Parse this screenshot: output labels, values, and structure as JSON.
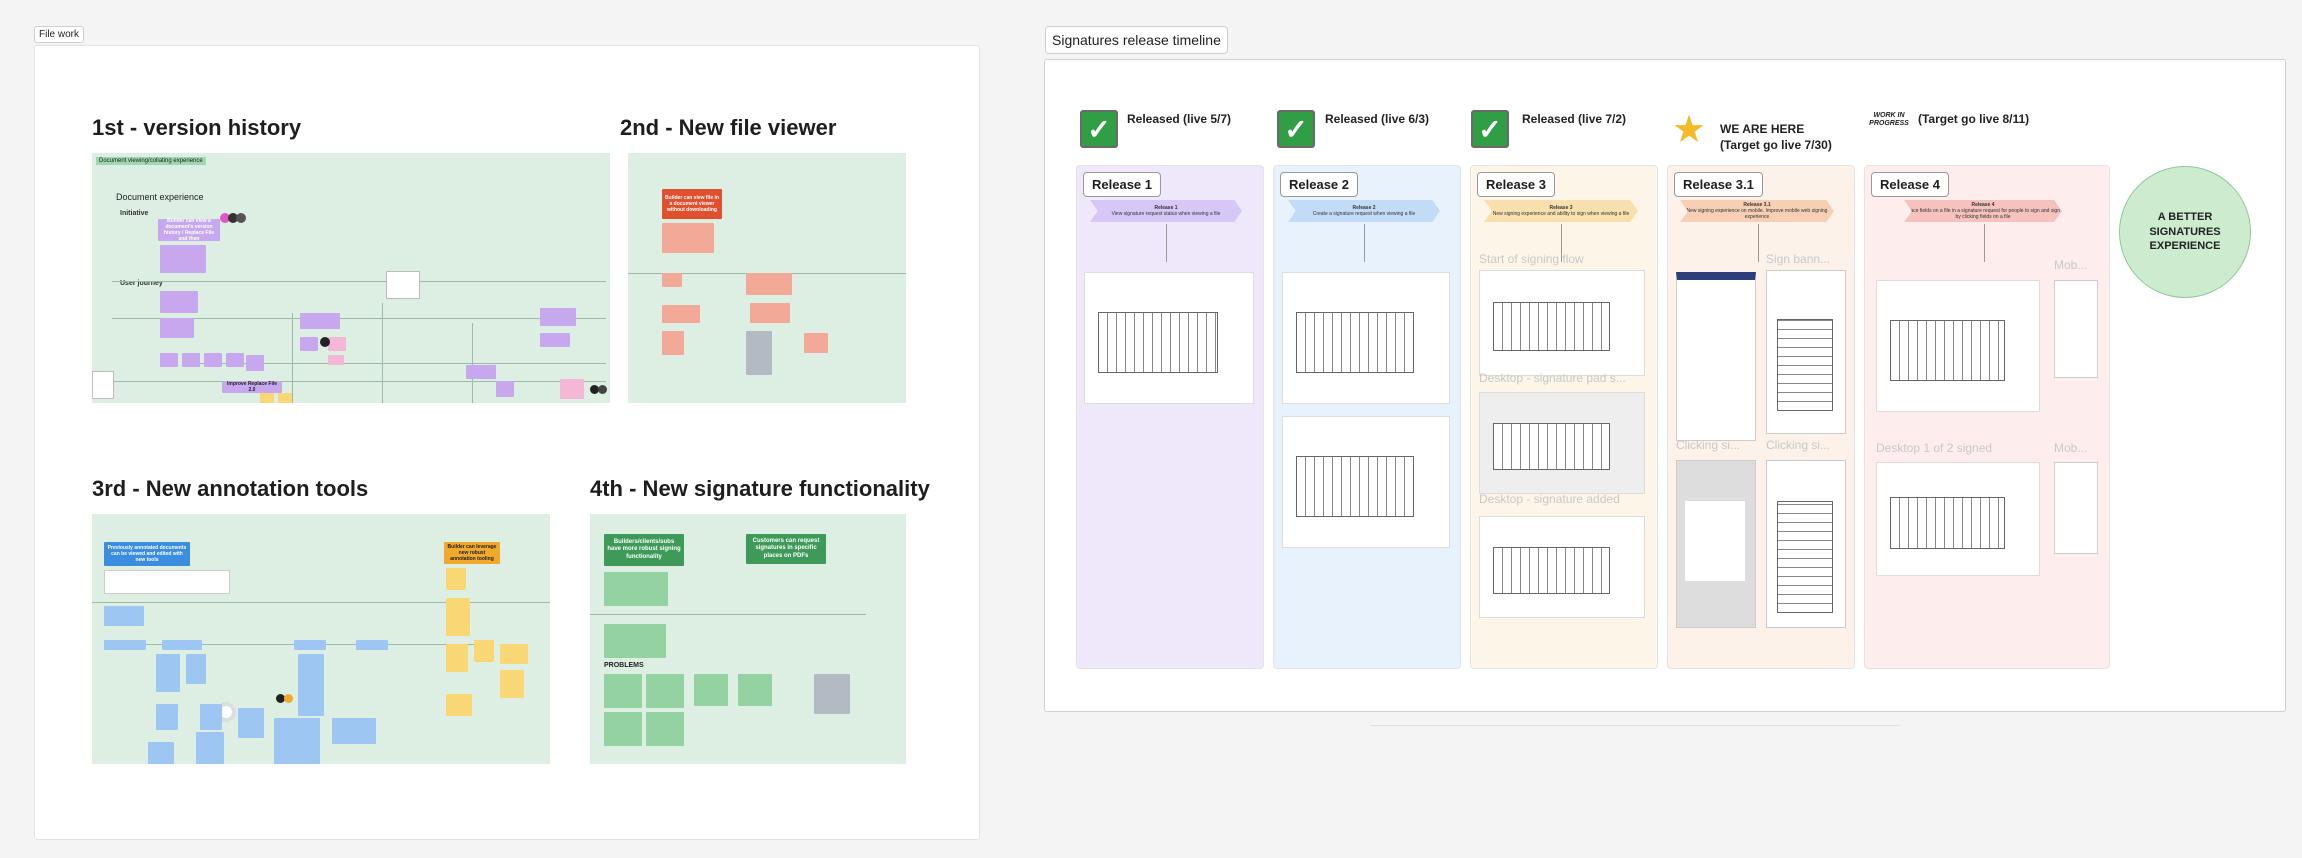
{
  "canvas_title": "",
  "file_work": {
    "tag": "File work",
    "sections": {
      "s1": {
        "title": "1st - version history"
      },
      "s2": {
        "title": "2nd - New file viewer"
      },
      "s3": {
        "title": "3rd - New annotation tools"
      },
      "s4": {
        "title": "4th - New signature functionality"
      }
    },
    "board1": {
      "header_label": "Document viewing/collating experience",
      "doc_experience": "Document experience",
      "initiative": "Initiative",
      "user_journey": "User journey",
      "sticky_main": "Builder can view a document's version history / Replace File and then",
      "sticky_replace": "Improve Replace File 2.0"
    },
    "board2": {
      "sticky_main": "Builder can view file in a document viewer without downloading"
    },
    "board3": {
      "sticky_main": "Previously annotated documents can be viewed and edited with new tools",
      "sticky_right": "Builder can leverage new robust annotation tooling"
    },
    "board4": {
      "sticky_left": "Builders/clients/subs have more robust signing functionality",
      "sticky_right": "Customers can request signatures in specific places on PDFs",
      "problems": "PROBLEMS"
    }
  },
  "timeline": {
    "tag": "Signatures release timeline",
    "columns": [
      {
        "status": "Released (live 5/7)",
        "status2": "",
        "release": "Release 1",
        "icon": "check-icon",
        "banner_title": "Release 1",
        "banner_text": "View signature request status when viewing a file",
        "color": "#efe8fb",
        "banner_color": "#d7c7f6"
      },
      {
        "status": "Released (live 6/3)",
        "status2": "",
        "release": "Release 2",
        "icon": "check-icon",
        "banner_title": "Release 2",
        "banner_text": "Create a signature request when viewing a file",
        "color": "#e6f1fc",
        "banner_color": "#c2dcf7"
      },
      {
        "status": "Released (live 7/2)",
        "status2": "",
        "release": "Release 3",
        "icon": "check-icon",
        "banner_title": "Release 3",
        "banner_text": "New signing experience and ability to sign when viewing a file",
        "color": "#fdf4e3",
        "banner_color": "#f8dfae"
      },
      {
        "status": "WE ARE HERE",
        "status2": "(Target go live 7/30)",
        "release": "Release 3.1",
        "icon": "star-icon",
        "banner_title": "Release 3.1",
        "banner_text": "New signing experience on mobile. Improve mobile web signing experience",
        "color": "#fdf0e6",
        "banner_color": "#f6cfb4"
      },
      {
        "status": "(Target go live 8/11)",
        "status2": "",
        "release": "Release 4",
        "icon": "work-in-progress-icon",
        "banner_title": "Release 4",
        "banner_text": "Place fields on a file in a signature request for people to sign and sign by clicking fields on a file",
        "color": "#fdeceb",
        "banner_color": "#f6c2bd"
      }
    ],
    "wip_text": "WORK IN PROGRESS",
    "ghost_labels": {
      "start_flow": "Start of signing flow",
      "pad": "Desktop - signature pad s...",
      "added": "Desktop - signature added",
      "sign_banner": "Sign bann...",
      "clicking1": "Clicking si...",
      "clicking2": "Clicking si...",
      "mob1": "Mob...",
      "desktop_1of2": "Desktop 1 of 2 signed",
      "mob2": "Mob..."
    },
    "goal": "A BETTER SIGNATURES EXPERIENCE"
  }
}
